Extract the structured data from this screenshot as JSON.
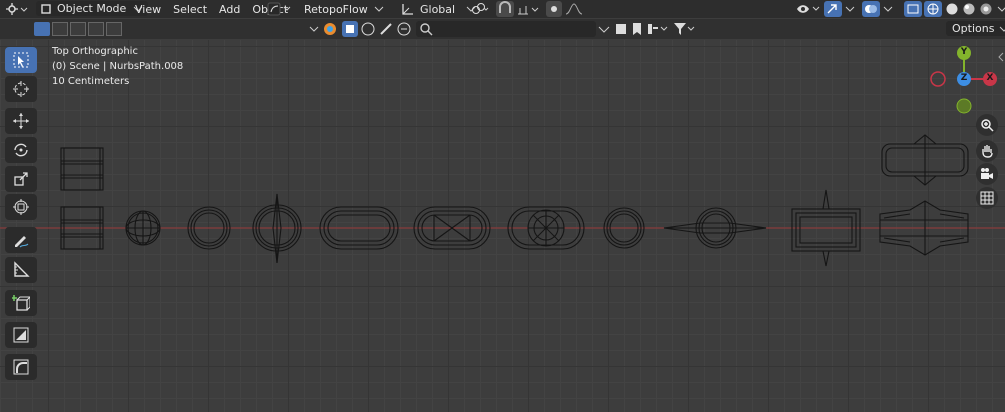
{
  "header": {
    "mode_label": "Object Mode",
    "menus": [
      "View",
      "Select",
      "Add",
      "Object"
    ],
    "addon_label": "RetopoFlow",
    "transform_orientation": "Global",
    "options_label": "Options"
  },
  "overlay": {
    "view_name": "Top Orthographic",
    "object_info": "(0) Scene | NurbsPath.008",
    "grid_scale": "10 Centimeters"
  },
  "gizmo": {
    "x_label": "X",
    "y_label": "Y",
    "z_label": "Z"
  },
  "colors": {
    "accent": "#4772b3",
    "x_axis": "#c83648",
    "y_axis": "#83b42c",
    "z_axis": "#3d8ee3",
    "x_line": "#9a3a3a"
  },
  "tools": [
    "select-box",
    "cursor",
    "move",
    "rotate",
    "scale",
    "transform",
    "annotate",
    "measure",
    "add-cube",
    "extrude",
    "bevel"
  ],
  "nav_buttons": [
    "zoom-icon",
    "pan-icon",
    "camera-icon",
    "ortho-grid-icon"
  ]
}
